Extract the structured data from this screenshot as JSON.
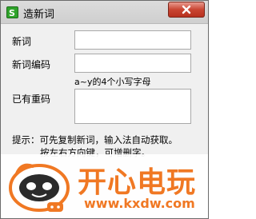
{
  "window": {
    "title": "造新词",
    "close_icon": "close-icon",
    "app_icon": "input-method-icon"
  },
  "form": {
    "new_word_label": "新词",
    "new_word_value": "",
    "code_label": "新词编码",
    "code_value": "",
    "code_hint": "a~y的4个小写字母",
    "existing_label": "已有重码",
    "existing_value": ""
  },
  "tips": {
    "line1": "提示：可先复制新词，输入法自动获取。",
    "line2": "按左右方向键，可增删字。"
  },
  "watermark": {
    "logo_text": "开心电玩",
    "url": "www.kxdw.com"
  },
  "colors": {
    "accent": "#f07823",
    "close_button": "#c94532"
  }
}
